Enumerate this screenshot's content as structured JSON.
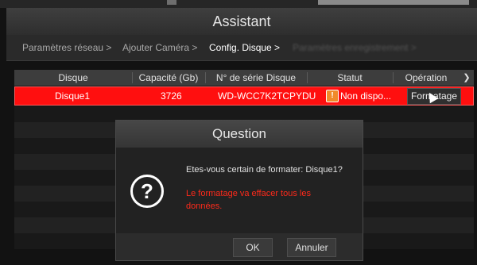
{
  "window": {
    "title": "Assistant"
  },
  "breadcrumbs": [
    {
      "label": "Paramètres réseau >"
    },
    {
      "label": "Ajouter Caméra >"
    },
    {
      "label": "Config. Disque >"
    },
    {
      "label": "Paramètres enregistrement >"
    }
  ],
  "table": {
    "headers": [
      "Disque",
      "Capacité (Gb)",
      "N° de série Disque",
      "Statut",
      "Opération"
    ],
    "rows": [
      {
        "disk": "Disque1",
        "capacity": "3726",
        "serial": "WD-WCC7K2TCPYDU",
        "status": "Non dispo...",
        "action": "Formatage"
      }
    ]
  },
  "dialog": {
    "title": "Question",
    "message": "Etes-vous certain de formater: Disque1?",
    "warning": "Le formatage va effacer tous les données.",
    "ok_label": "OK",
    "cancel_label": "Annuler"
  },
  "icons": {
    "dropdown": "chevron-down-icon",
    "status": "warning-icon",
    "question": "question-icon"
  },
  "colors": {
    "selected_row": "#ff0f0f",
    "warning_text": "#ff2a1a"
  }
}
